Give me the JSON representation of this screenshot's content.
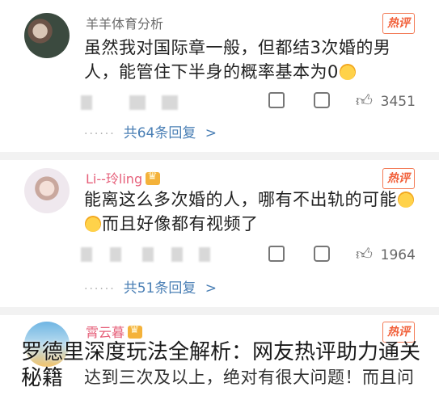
{
  "comments": [
    {
      "username": "羊羊体育分析",
      "badge": "热评",
      "text": "虽然我对国际章一般，但都结3次婚的男人，能管住下半身的概率基本为0",
      "likes": "3451",
      "replies": "共64条回复",
      "reply_arrow": ">"
    },
    {
      "username": "Li--玲ling",
      "badge": "热评",
      "text_line1": "能离这么多次婚的人，哪有不出轨的可能",
      "text_line2": "而且好像都有视频了",
      "likes": "1964",
      "replies": "共51条回复",
      "reply_arrow": ">"
    },
    {
      "username": "霄云暮",
      "badge": "热评",
      "text": "达到三次及以上，绝对有很大问题！而且问"
    }
  ],
  "overlay_caption": "罗德里深度玩法全解析：网友热评助力通关秘籍",
  "colors": {
    "hot_badge": "#f1603a",
    "reply_link": "#4a7fb5",
    "username_vip": "#e6607a"
  },
  "icons": [
    "share-icon",
    "comment-icon",
    "like-icon",
    "vip-crown-icon",
    "laugh-emoji-icon"
  ]
}
